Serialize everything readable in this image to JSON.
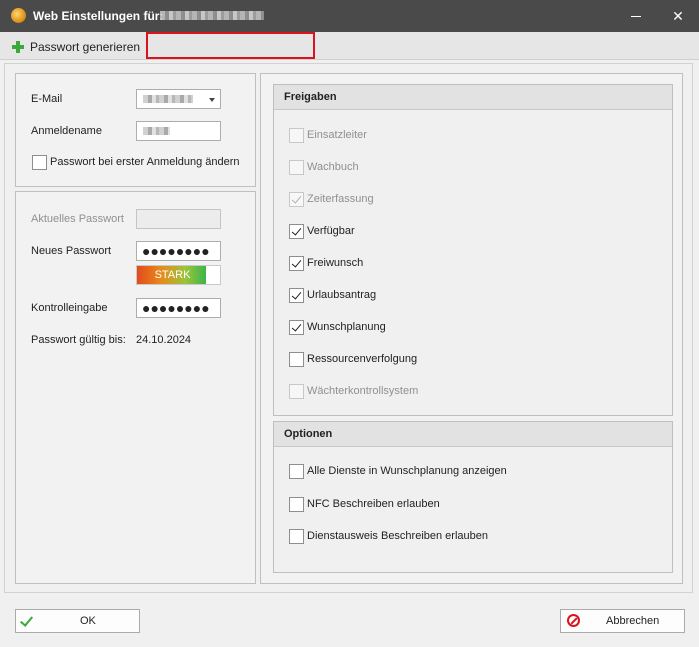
{
  "window": {
    "title": "Web Einstellungen für:",
    "close_glyph": "✕"
  },
  "toolbar": {
    "generate_label": "Passwort generieren"
  },
  "account": {
    "email_label": "E-Mail",
    "login_label": "Anmeldename",
    "change_on_first_login_label": "Passwort bei erster Anmeldung ändern",
    "change_on_first_login_checked": false
  },
  "password": {
    "current_label": "Aktuelles Passwort",
    "new_label": "Neues Passwort",
    "new_value": "●●●●●●●●",
    "strength_label": "STARK",
    "strength_fraction": 0.83,
    "confirm_label": "Kontrolleingabe",
    "confirm_value": "●●●●●●●●",
    "valid_until_label": "Passwort gültig bis:",
    "valid_until_value": "24.10.2024"
  },
  "freigaben": {
    "title": "Freigaben",
    "items": [
      {
        "label": "Einsatzleiter",
        "checked": false,
        "enabled": false
      },
      {
        "label": "Wachbuch",
        "checked": false,
        "enabled": false
      },
      {
        "label": "Zeiterfassung",
        "checked": true,
        "enabled": false
      },
      {
        "label": "Verfügbar",
        "checked": true,
        "enabled": true
      },
      {
        "label": "Freiwunsch",
        "checked": true,
        "enabled": true
      },
      {
        "label": "Urlaubsantrag",
        "checked": true,
        "enabled": true
      },
      {
        "label": "Wunschplanung",
        "checked": true,
        "enabled": true
      },
      {
        "label": "Ressourcenverfolgung",
        "checked": false,
        "enabled": true
      },
      {
        "label": "Wächterkontrollsystem",
        "checked": false,
        "enabled": false
      }
    ]
  },
  "optionen": {
    "title": "Optionen",
    "items": [
      {
        "label": "Alle Dienste in Wunschplanung anzeigen",
        "checked": false
      },
      {
        "label": "NFC Beschreiben erlauben",
        "checked": false
      },
      {
        "label": "Dienstausweis Beschreiben erlauben",
        "checked": false
      }
    ]
  },
  "footer": {
    "ok_label": "OK",
    "cancel_label": "Abbrechen"
  },
  "colors": {
    "titlebar": "#4a4a4a",
    "highlight_box": "#d9141e",
    "ok_icon": "#3aa83a",
    "cancel_icon": "#d9141e"
  }
}
